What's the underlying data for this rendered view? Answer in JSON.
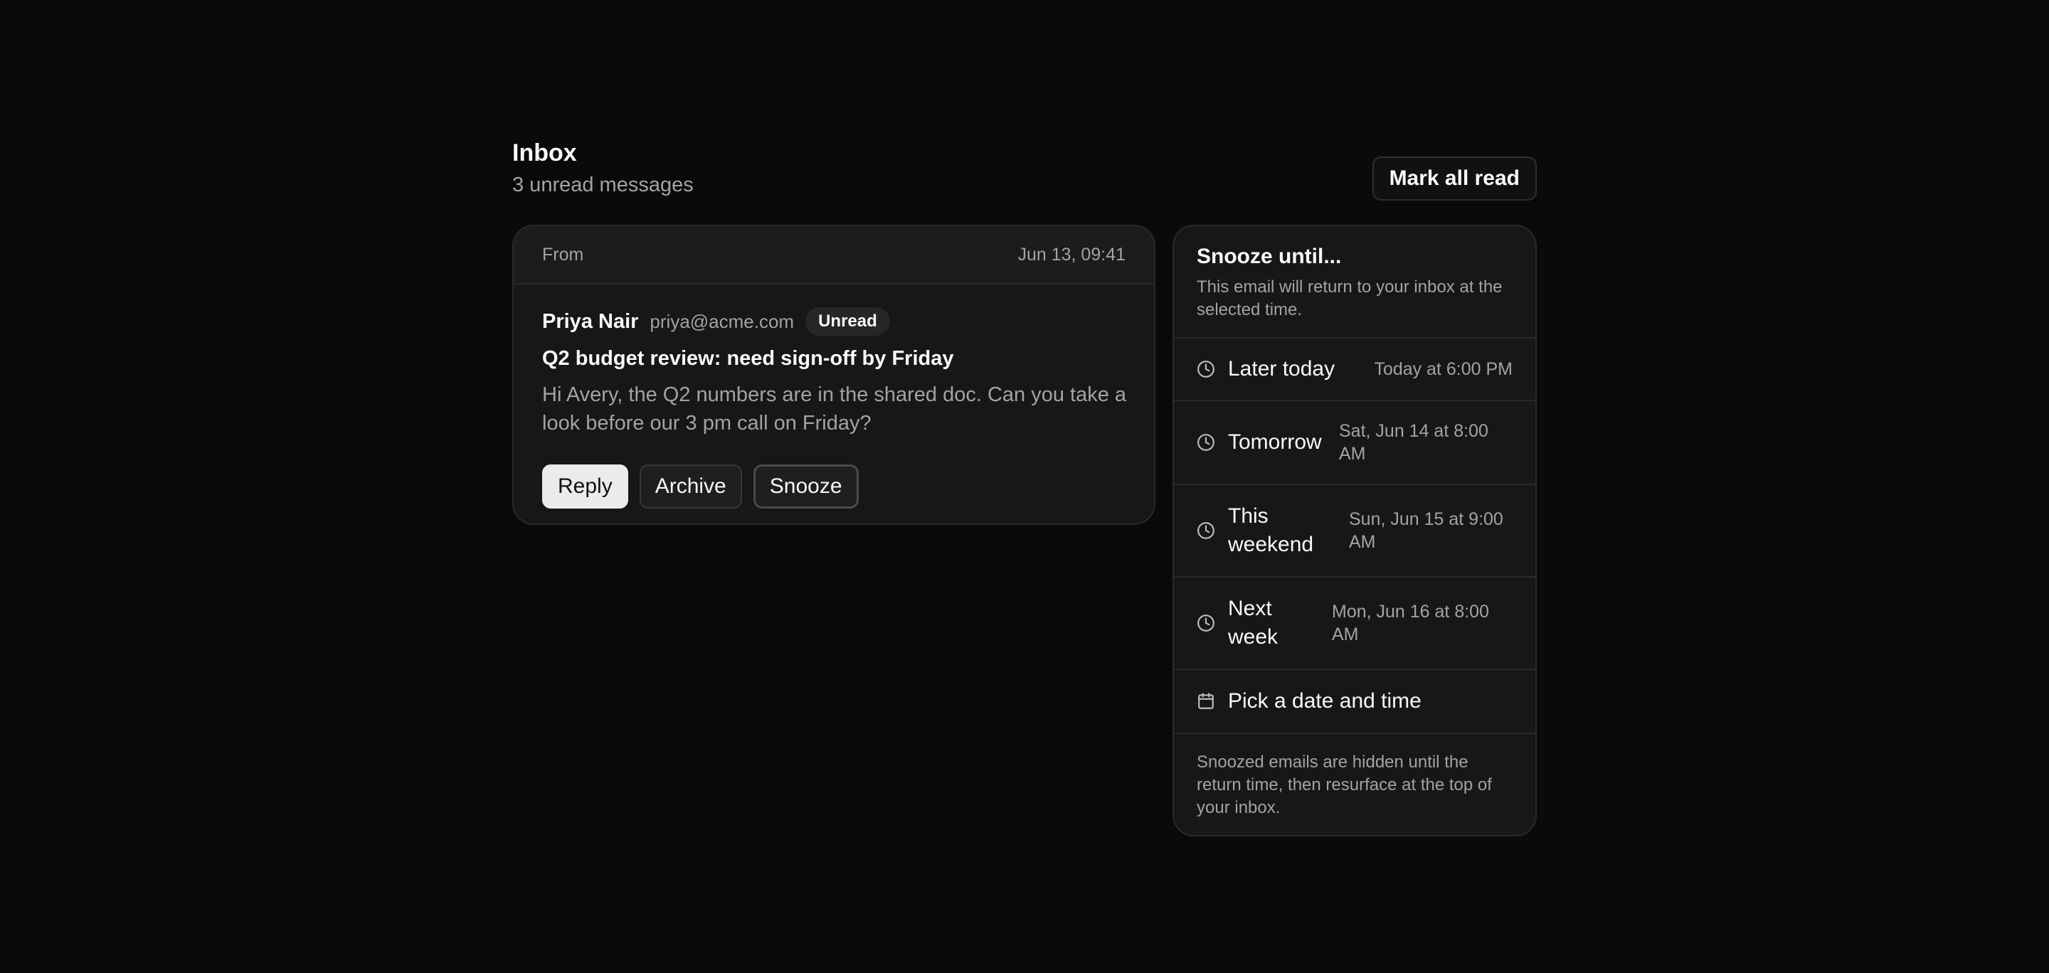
{
  "header": {
    "title": "Inbox",
    "subtitle": "3 unread messages",
    "mark_all_read": "Mark all read"
  },
  "email": {
    "from_label": "From",
    "date": "Jun 13, 09:41",
    "sender_name": "Priya Nair",
    "sender_email": "priya@acme.com",
    "badge": "Unread",
    "subject": "Q2 budget review: need sign-off by Friday",
    "preview": "Hi Avery, the Q2 numbers are in the shared doc. Can you take a look before our 3 pm call on Friday?",
    "actions": {
      "reply": "Reply",
      "archive": "Archive",
      "snooze": "Snooze"
    }
  },
  "snooze": {
    "title": "Snooze until...",
    "description": "This email will return to your inbox at the selected time.",
    "options": [
      {
        "label": "Later today",
        "time": "Today at 6:00 PM",
        "icon": "clock-icon"
      },
      {
        "label": "Tomorrow",
        "time": "Sat, Jun 14 at 8:00 AM",
        "icon": "clock-icon"
      },
      {
        "label": "This weekend",
        "time": "Sun, Jun 15 at 9:00 AM",
        "icon": "clock-icon"
      },
      {
        "label": "Next week",
        "time": "Mon, Jun 16 at 8:00 AM",
        "icon": "clock-icon"
      }
    ],
    "pick_label": "Pick a date and time",
    "pick_icon": "calendar-icon",
    "footer": "Snoozed emails are hidden until the return time, then resurface at the top of your inbox."
  }
}
